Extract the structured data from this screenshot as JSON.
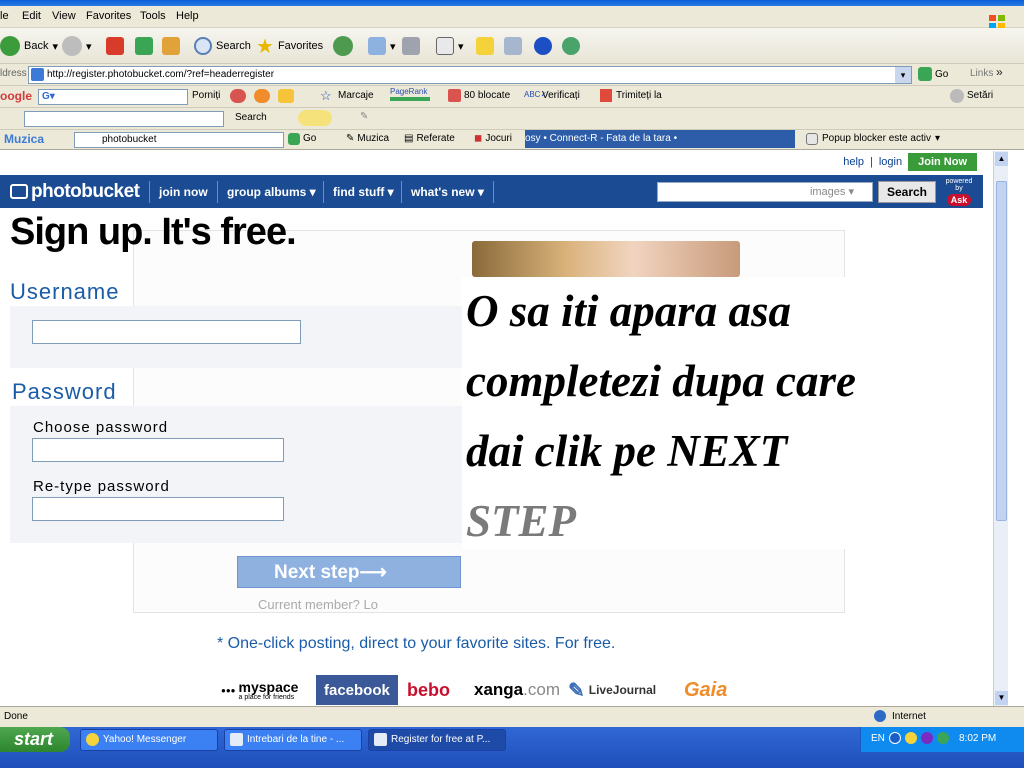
{
  "menu": {
    "items": [
      "le",
      "Edit",
      "View",
      "Favorites",
      "Tools",
      "Help"
    ]
  },
  "toolbar": {
    "back": "Back",
    "search": "Search",
    "favorites": "Favorites"
  },
  "address": {
    "label": "ldress",
    "url": "http://register.photobucket.com/?ref=headerregister",
    "go": "Go",
    "links": "Links"
  },
  "googlebar": {
    "logo": "oogle",
    "porniti": "Porniți",
    "marcaje": "Marcaje",
    "pagerank": "PageRank",
    "blocked": "80 blocate",
    "verificati": "Verificați",
    "trimiteti": "Trimiteți la",
    "setari": "Setări"
  },
  "searchbar2": {
    "search": "Search"
  },
  "linksbar": {
    "muzica_brand": "Muzica",
    "query": "photobucket",
    "go": "Go",
    "muzica": "Muzica",
    "referate": "Referate",
    "jocuri": "Jocuri",
    "ticker": "osy • Connect-R - Fata de la tara •",
    "popup": "Popup blocker este activ"
  },
  "site": {
    "help": "help",
    "sep": "|",
    "login": "login",
    "join_now": "Join Now",
    "logo": "photobucket",
    "nav": [
      "join now",
      "group albums ▾",
      "find stuff ▾",
      "what's new ▾"
    ],
    "search_scope": "images ▾",
    "search_button": "Search",
    "powered_by": "powered by",
    "ask": "Ask"
  },
  "form": {
    "heading": "Sign up. It's free.",
    "username_label": "Username",
    "password_label": "Password",
    "choose_password": "Choose password",
    "retype_password": "Re-type password",
    "next_step": "Next step⟶",
    "current_member": "Current member? Lo",
    "promo": "* One-click posting, direct to your favorite sites. For free."
  },
  "overlay": {
    "line1": "O sa iti apara asa",
    "line2": "completezi dupa care",
    "line3": "dai clik pe NEXT",
    "line4": "STEP"
  },
  "brands": {
    "myspace": "myspace",
    "myspace_tag": "a place for friends",
    "facebook": "facebook",
    "bebo": "bebo",
    "xanga": "xanga",
    "xanga_dom": ".com",
    "livejournal": "LiveJournal",
    "gaia": "Gaia"
  },
  "status": {
    "done": "Done",
    "zone": "Internet"
  },
  "taskbar": {
    "start": "start",
    "tasks": [
      "Yahoo! Messenger",
      "Intrebari de la tine - ...",
      "Register for free at P..."
    ],
    "lang": "EN",
    "clock": "8:02 PM"
  },
  "colors": {
    "nav_blue": "#1b4b93",
    "join_green": "#3a9b3a",
    "label_blue": "#1a5ca8",
    "taskbar_blue": "#3168d5"
  }
}
